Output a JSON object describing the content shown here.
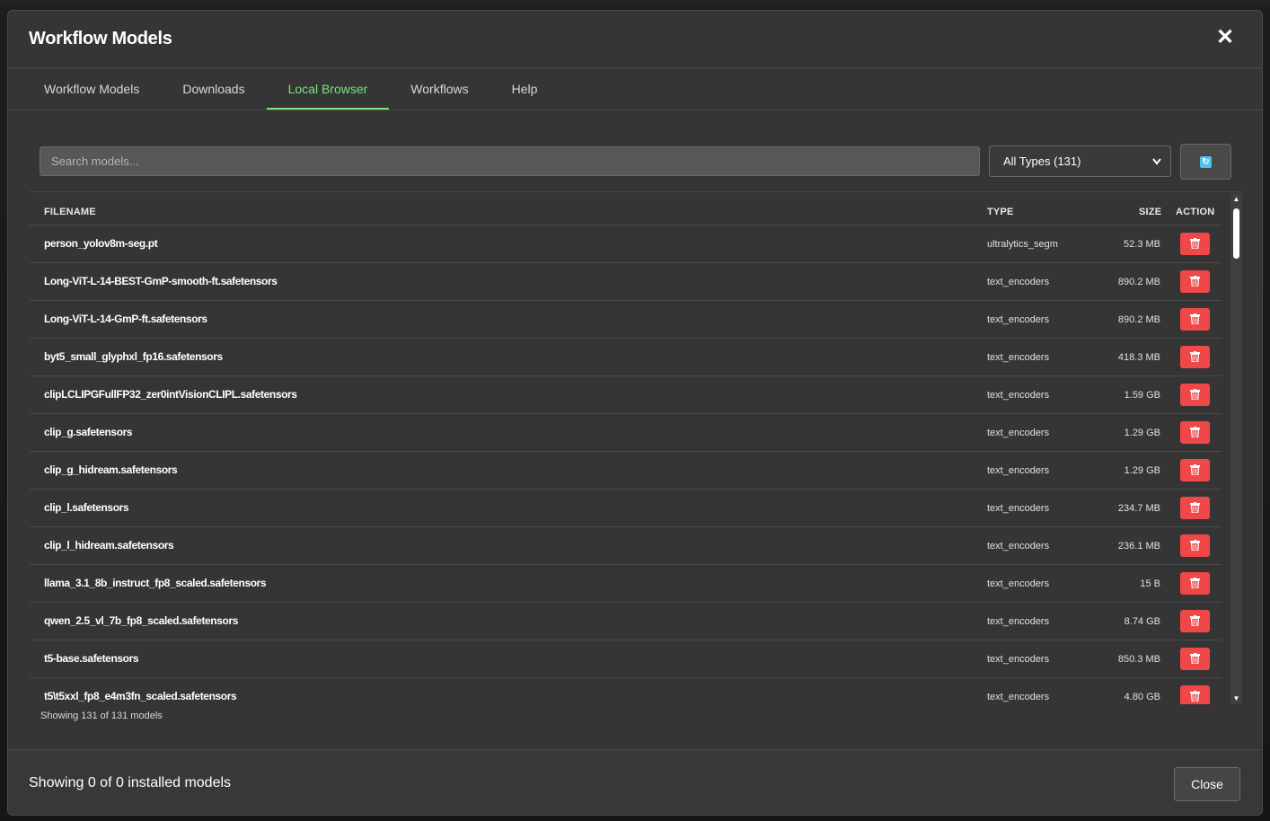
{
  "modal": {
    "title": "Workflow Models",
    "close_glyph": "✕"
  },
  "tabs": [
    {
      "label": "Workflow Models",
      "active": false
    },
    {
      "label": "Downloads",
      "active": false
    },
    {
      "label": "Local Browser",
      "active": true
    },
    {
      "label": "Workflows",
      "active": false
    },
    {
      "label": "Help",
      "active": false
    }
  ],
  "search": {
    "placeholder": "Search models...",
    "value": ""
  },
  "type_filter": {
    "selected": "All Types (131)"
  },
  "table": {
    "headers": {
      "filename": "FILENAME",
      "type": "TYPE",
      "size": "SIZE",
      "action": "ACTION"
    },
    "rows": [
      {
        "filename": "person_yolov8m-seg.pt",
        "type": "ultralytics_segm",
        "size": "52.3 MB"
      },
      {
        "filename": "Long-ViT-L-14-BEST-GmP-smooth-ft.safetensors",
        "type": "text_encoders",
        "size": "890.2 MB"
      },
      {
        "filename": "Long-ViT-L-14-GmP-ft.safetensors",
        "type": "text_encoders",
        "size": "890.2 MB"
      },
      {
        "filename": "byt5_small_glyphxl_fp16.safetensors",
        "type": "text_encoders",
        "size": "418.3 MB"
      },
      {
        "filename": "clipLCLIPGFullFP32_zer0intVisionCLIPL.safetensors",
        "type": "text_encoders",
        "size": "1.59 GB"
      },
      {
        "filename": "clip_g.safetensors",
        "type": "text_encoders",
        "size": "1.29 GB"
      },
      {
        "filename": "clip_g_hidream.safetensors",
        "type": "text_encoders",
        "size": "1.29 GB"
      },
      {
        "filename": "clip_l.safetensors",
        "type": "text_encoders",
        "size": "234.7 MB"
      },
      {
        "filename": "clip_l_hidream.safetensors",
        "type": "text_encoders",
        "size": "236.1 MB"
      },
      {
        "filename": "llama_3.1_8b_instruct_fp8_scaled.safetensors",
        "type": "text_encoders",
        "size": "15 B"
      },
      {
        "filename": "qwen_2.5_vl_7b_fp8_scaled.safetensors",
        "type": "text_encoders",
        "size": "8.74 GB"
      },
      {
        "filename": "t5-base.safetensors",
        "type": "text_encoders",
        "size": "850.3 MB"
      },
      {
        "filename": "t5\\t5xxl_fp8_e4m3fn_scaled.safetensors",
        "type": "text_encoders",
        "size": "4.80 GB"
      }
    ],
    "showing": "Showing 131 of 131 models"
  },
  "footer": {
    "status": "Showing 0 of 0 installed models",
    "close_label": "Close"
  },
  "colors": {
    "accent_tab": "#7be37b",
    "delete": "#f04848",
    "refresh_icon": "#4cc3f0"
  },
  "icons": {
    "refresh": "refresh-icon",
    "delete": "trash-icon",
    "dropdown": "chevron-down-icon",
    "close": "close-icon"
  }
}
